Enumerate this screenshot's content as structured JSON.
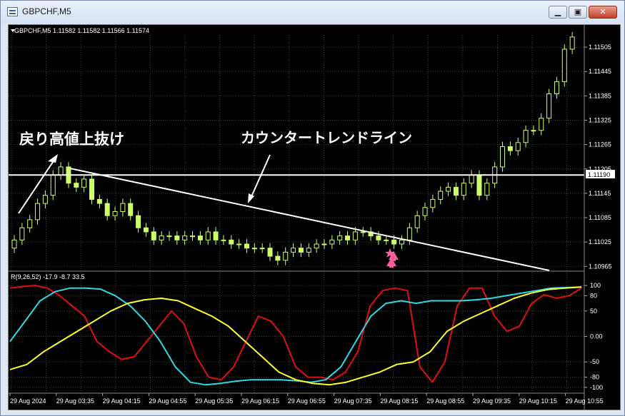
{
  "window": {
    "title": "GBPCHF,M5",
    "buttons": [
      "minimize",
      "restore",
      "close"
    ]
  },
  "main": {
    "info": "GBPCHF,M5  1.11582 1.11582 1.11566 1.11574",
    "price_ticks": [
      "1.11505",
      "1.11445",
      "1.11385",
      "1.11325",
      "1.11265",
      "1.11205",
      "1.11145",
      "1.11085",
      "1.11025",
      "1.10965"
    ],
    "current_price": "1.11190",
    "annotations": {
      "breakout": "戻り高値上抜け",
      "counter_trendline": "カウンタートレンドライン"
    }
  },
  "sub": {
    "indicator_label": "R(9,26,52) -17.9 -8.7 33.5",
    "y_ticks": [
      "100",
      "80",
      "50",
      "0.00",
      "-50",
      "-80",
      "-100"
    ]
  },
  "time_axis": [
    "29 Aug 2024",
    "29 Aug 03:35",
    "29 Aug 04:15",
    "29 Aug 04:55",
    "29 Aug 05:35",
    "29 Aug 06:15",
    "29 Aug 06:55",
    "29 Aug 07:35",
    "29 Aug 08:15",
    "29 Aug 08:55",
    "29 Aug 09:35",
    "29 Aug 10:15",
    "29 Aug 10:55"
  ],
  "colors": {
    "background": "#000000",
    "candle": "#ccff66",
    "grid": "#3a4a3a",
    "line_red": "#e01010",
    "line_cyan": "#30d8ec",
    "line_yellow": "#ffff28",
    "signal_pink": "#ff5f9f",
    "trendline": "#ffffff"
  },
  "chart_data": {
    "type": "line",
    "price_axis": {
      "ylim": [
        1.10955,
        1.11535
      ]
    },
    "closes": [
      1.1103,
      1.1106,
      1.1108,
      1.1112,
      1.1114,
      1.1119,
      1.1121,
      1.1117,
      1.1116,
      1.1118,
      1.1113,
      1.1112,
      1.1109,
      1.111,
      1.1112,
      1.1109,
      1.1106,
      1.1105,
      1.1103,
      1.1104,
      1.1104,
      1.1103,
      1.1104,
      1.1104,
      1.1103,
      1.1105,
      1.1103,
      1.1103,
      1.1102,
      1.1102,
      1.1101,
      1.1101,
      1.1101,
      1.1099,
      1.1098,
      1.11,
      1.1101,
      1.11,
      1.1101,
      1.1102,
      1.1102,
      1.1103,
      1.1104,
      1.1103,
      1.1105,
      1.1105,
      1.1104,
      1.1103,
      1.1103,
      1.1102,
      1.1103,
      1.1106,
      1.1109,
      1.1111,
      1.1113,
      1.1115,
      1.1116,
      1.1114,
      1.1117,
      1.1119,
      1.1114,
      1.1117,
      1.1121,
      1.1126,
      1.1125,
      1.1127,
      1.113,
      1.113,
      1.1133,
      1.1139,
      1.1142,
      1.115,
      1.1153
    ],
    "indicator": {
      "ylim": [
        -110,
        110
      ],
      "series": [
        {
          "values": [
            95,
            98,
            100,
            95,
            80,
            60,
            40,
            -10,
            -30,
            -45,
            -40,
            -10,
            20,
            50,
            25,
            -40,
            -80,
            -85,
            -60,
            -10,
            40,
            30,
            0,
            -60,
            -80,
            -80,
            -85,
            -70,
            -30,
            60,
            90,
            95,
            90,
            -60,
            -90,
            -50,
            60,
            95,
            95,
            40,
            10,
            20,
            65,
            82,
            75,
            80,
            95
          ]
        },
        {
          "values": [
            -10,
            30,
            70,
            88,
            95,
            95,
            93,
            80,
            60,
            30,
            -10,
            -60,
            -90,
            -95,
            -92,
            -88,
            -85,
            -85,
            -85,
            -87,
            -90,
            -85,
            -60,
            -10,
            40,
            65,
            70,
            65,
            70,
            70,
            70,
            72,
            75,
            80,
            85,
            90,
            95,
            96,
            97
          ]
        },
        {
          "values": [
            -65,
            -55,
            -30,
            -10,
            10,
            30,
            50,
            65,
            72,
            75,
            70,
            55,
            40,
            20,
            -10,
            -40,
            -70,
            -85,
            -92,
            -95,
            -90,
            -80,
            -70,
            -55,
            -50,
            -30,
            10,
            30,
            45,
            60,
            75,
            85,
            92,
            95,
            97
          ]
        }
      ]
    }
  }
}
